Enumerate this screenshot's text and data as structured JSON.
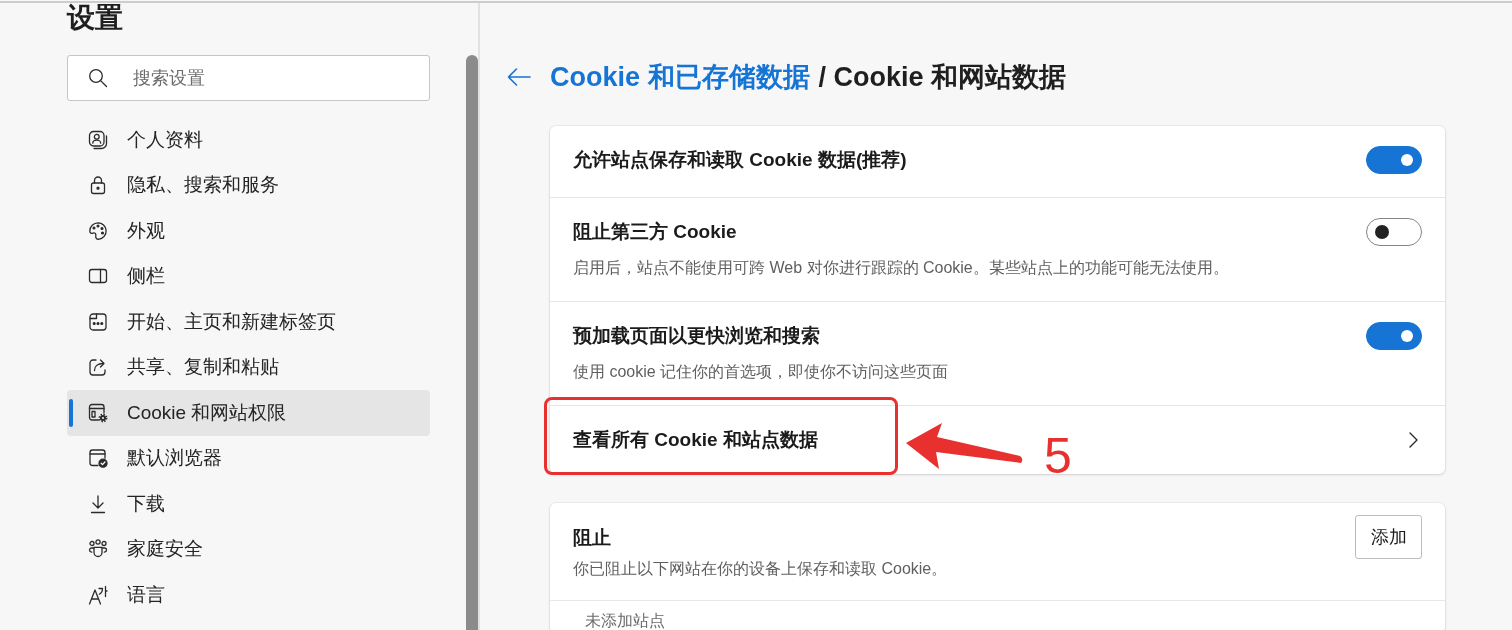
{
  "sidebar": {
    "title": "设置",
    "search": {
      "placeholder": "搜索设置"
    },
    "items": [
      {
        "label": "个人资料",
        "selected": false
      },
      {
        "label": "隐私、搜索和服务",
        "selected": false
      },
      {
        "label": "外观",
        "selected": false
      },
      {
        "label": "侧栏",
        "selected": false
      },
      {
        "label": "开始、主页和新建标签页",
        "selected": false
      },
      {
        "label": "共享、复制和粘贴",
        "selected": false
      },
      {
        "label": "Cookie 和网站权限",
        "selected": true
      },
      {
        "label": "默认浏览器",
        "selected": false
      },
      {
        "label": "下载",
        "selected": false
      },
      {
        "label": "家庭安全",
        "selected": false
      },
      {
        "label": "语言",
        "selected": false
      }
    ]
  },
  "main": {
    "breadcrumb": {
      "parent": "Cookie 和已存储数据",
      "current": "/ Cookie 和网站数据"
    },
    "cards": [
      {
        "rows": [
          {
            "kind": "toggle",
            "title": "允许站点保存和读取 Cookie 数据(推荐)",
            "on": true
          },
          {
            "kind": "toggle",
            "title": "阻止第三方 Cookie",
            "description": "启用后，站点不能使用可跨 Web 对你进行跟踪的 Cookie。某些站点上的功能可能无法使用。",
            "on": false
          },
          {
            "kind": "toggle",
            "title": "预加载页面以更快浏览和搜索",
            "description": "使用 cookie 记住你的首选项，即使你不访问这些页面",
            "on": true
          },
          {
            "kind": "link",
            "title": "查看所有 Cookie 和站点数据",
            "highlighted": true,
            "callout": "5"
          }
        ]
      },
      {
        "rows": [
          {
            "kind": "action",
            "title": "阻止",
            "description": "你已阻止以下网站在你的设备上保存和读取 Cookie。",
            "button": "添加"
          },
          {
            "kind": "note",
            "text": "未添加站点"
          }
        ]
      }
    ]
  }
}
